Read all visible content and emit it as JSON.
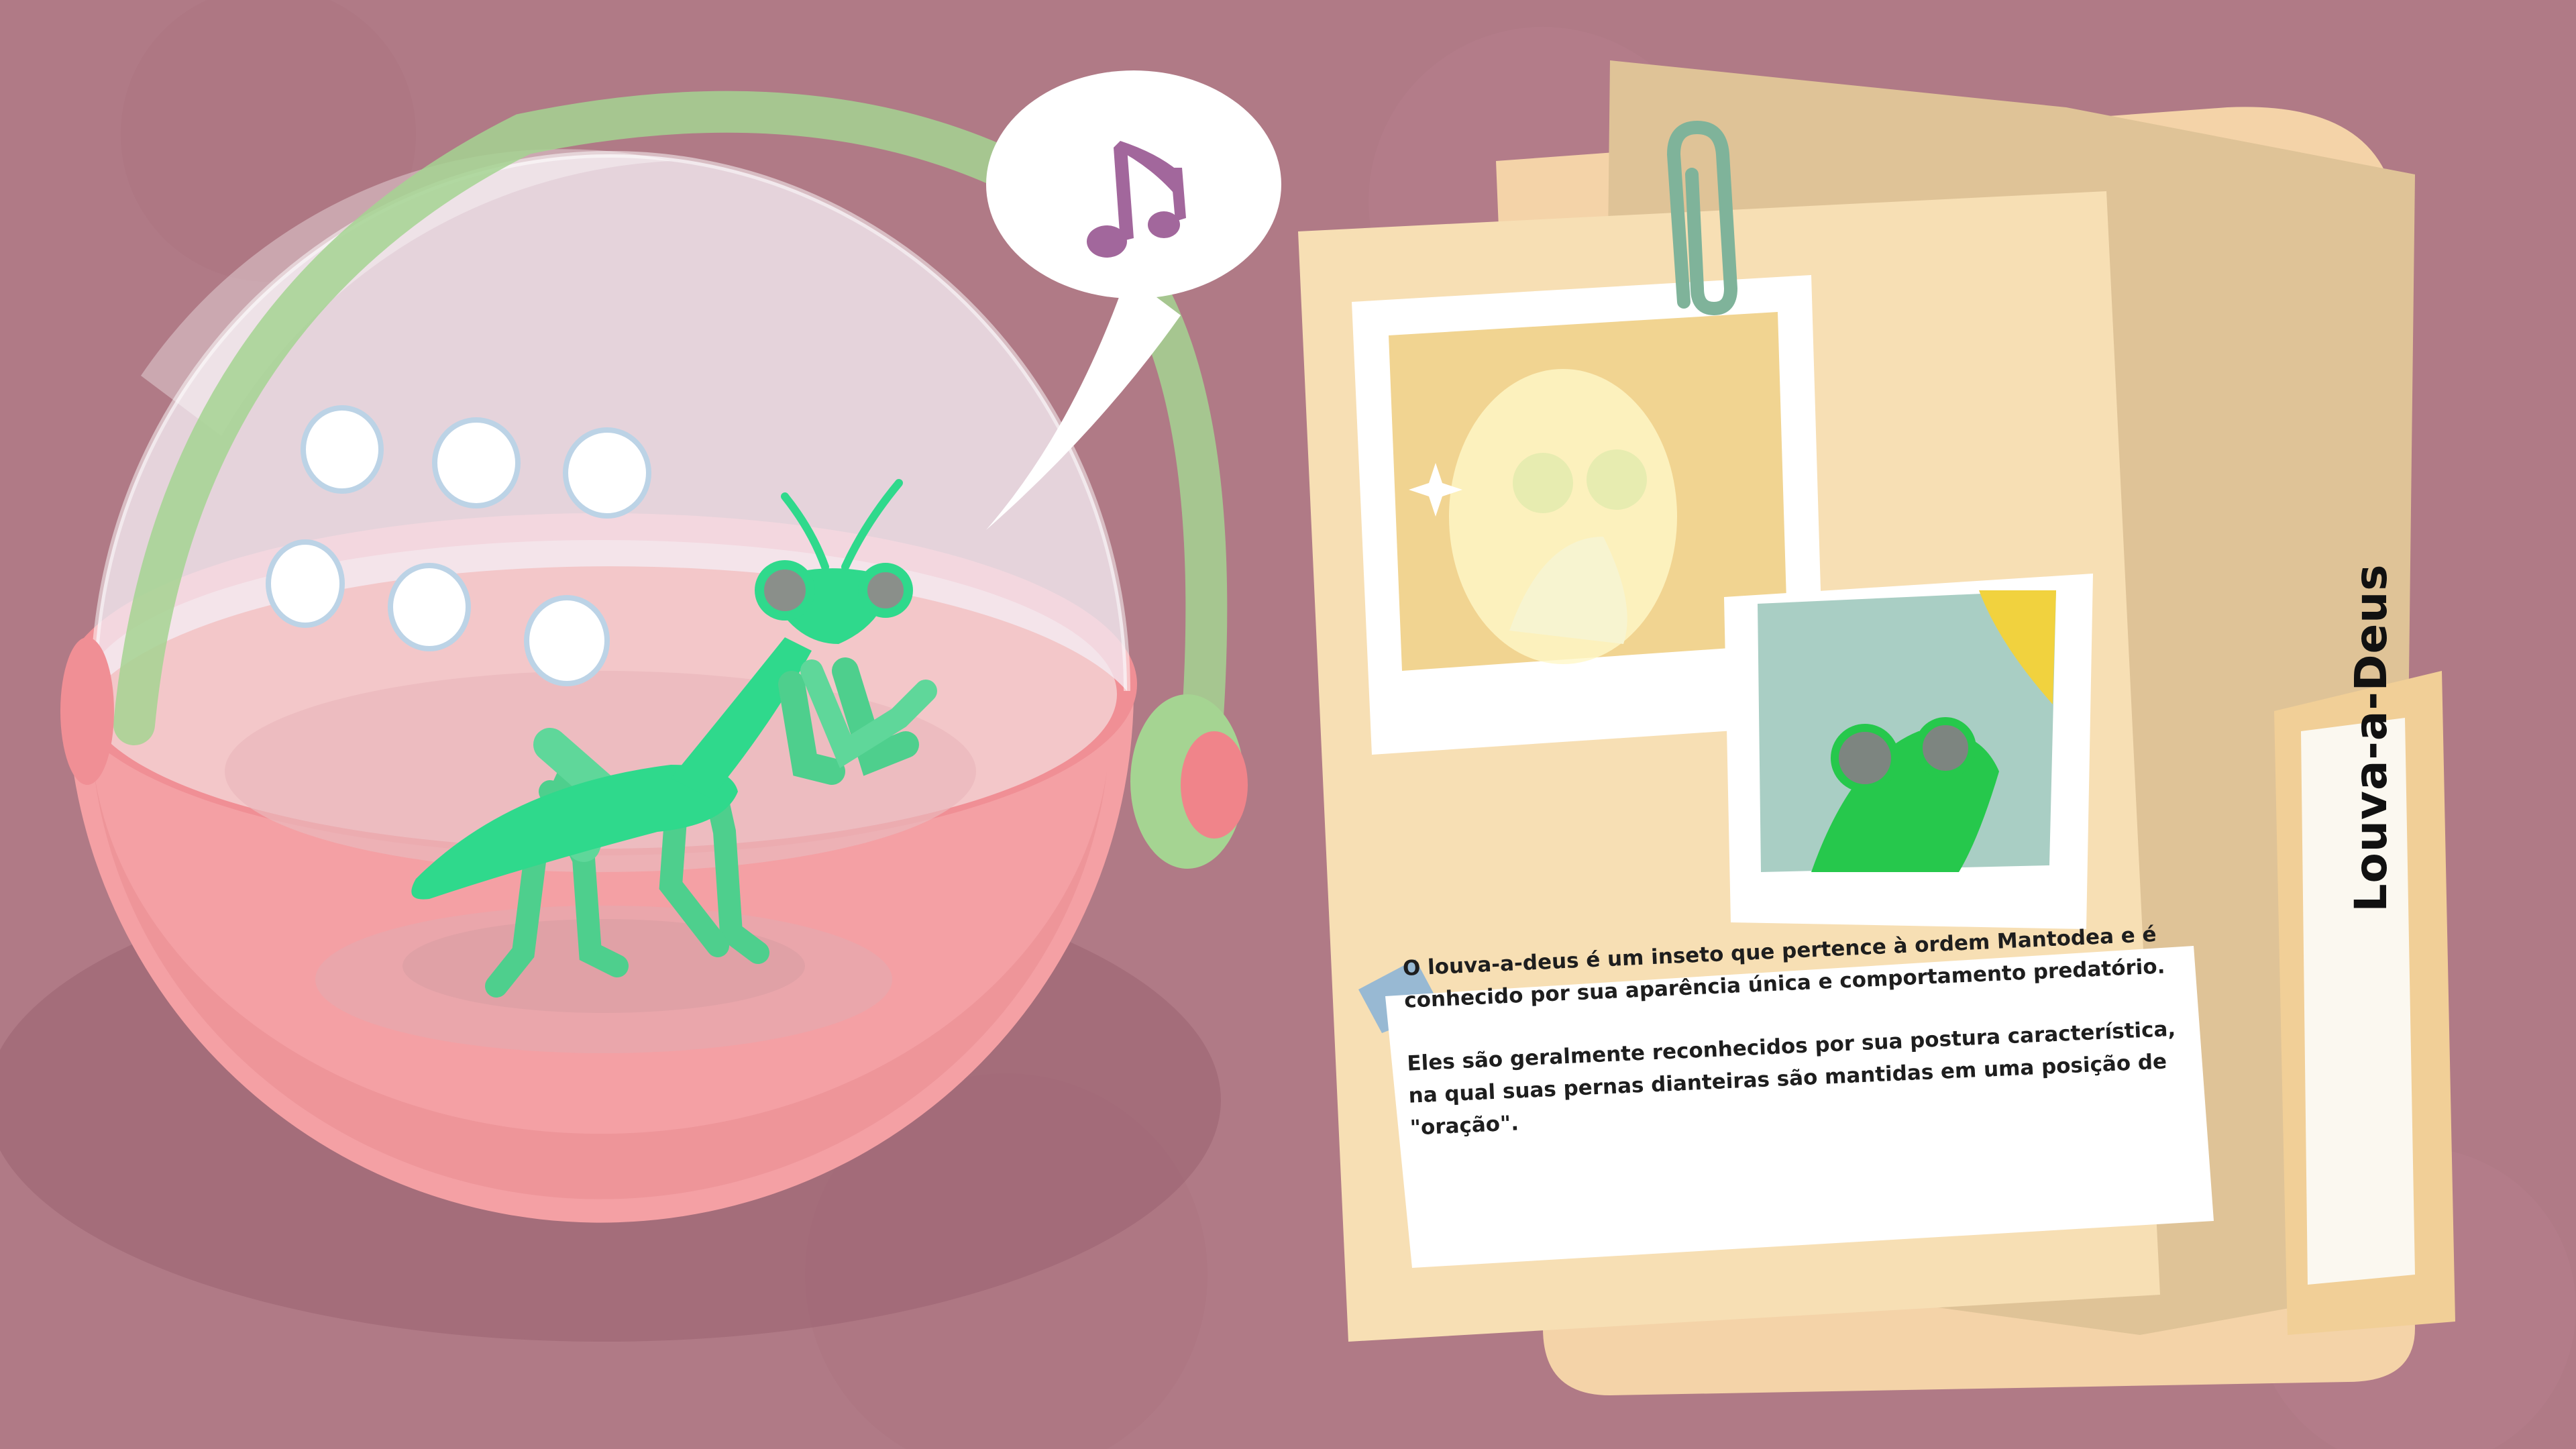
{
  "folder": {
    "tab_label": "Louva-a-Deus",
    "description": [
      "O louva-a-deus é um inseto que pertence à ordem Mantodea e é conhecido por sua aparência única e comportamento predatório.",
      "Eles são geralmente reconhecidos por sua postura característica, na qual suas pernas dianteiras são mantidas em uma posição de \"oração\"."
    ]
  },
  "speech_bubble": {
    "icon": "music-notes-icon"
  },
  "colors": {
    "background": "#b07a86",
    "capsule_pink": "#f4a0a4",
    "headphones_green": "#a5d492",
    "mantis_green": "#2fd98c",
    "folder_cream": "#f7dfb4",
    "note_purple": "#a2679c"
  }
}
